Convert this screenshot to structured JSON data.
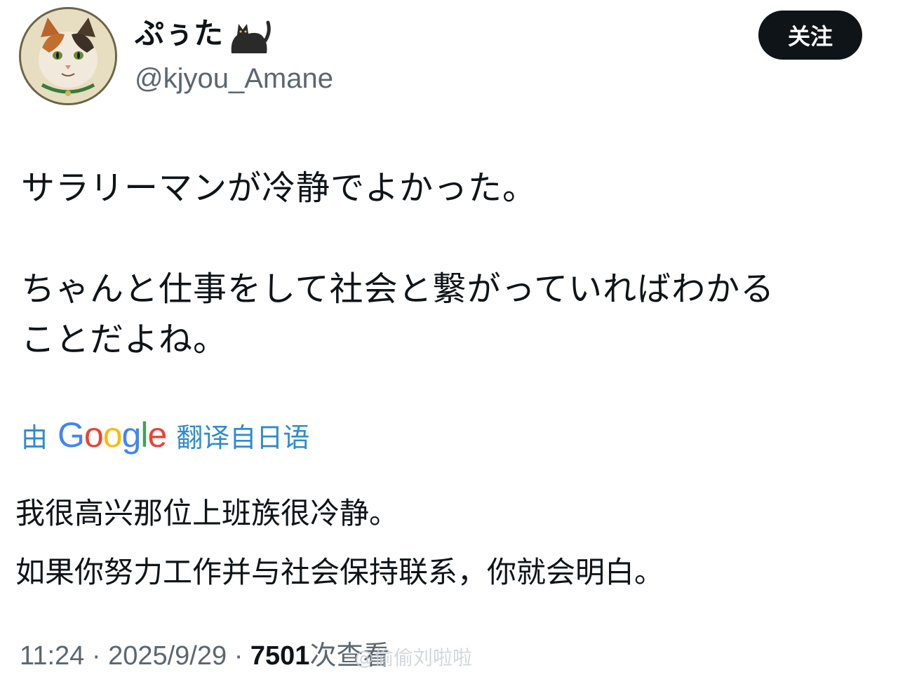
{
  "user": {
    "display_name": "ぷぅた",
    "display_name_emoji": "cat-icon",
    "handle": "@kjyou_Amane",
    "avatar": "calico-cat-portrait"
  },
  "follow_button": {
    "label": "关注"
  },
  "tweet": {
    "lines": [
      "サラリーマンが冷静でよかった。",
      "ちゃんと仕事をして社会と繋がっていればわかる",
      "ことだよね。"
    ]
  },
  "translation": {
    "prefix": "由",
    "provider": "Google",
    "suffix": "翻译自日语",
    "lines": [
      "我很高兴那位上班族很冷静。",
      "如果你努力工作并与社会保持联系，你就会明白。"
    ]
  },
  "meta": {
    "time": "11:24",
    "separator": "·",
    "date": "2025/9/29",
    "views_count": "7501",
    "views_label": "次查看"
  },
  "watermark": {
    "text": "@偷偷刘啦啦"
  },
  "colors": {
    "follow_bg": "#0f1419",
    "link_blue": "#1d9bf0",
    "secondary_text": "#5b6670"
  }
}
